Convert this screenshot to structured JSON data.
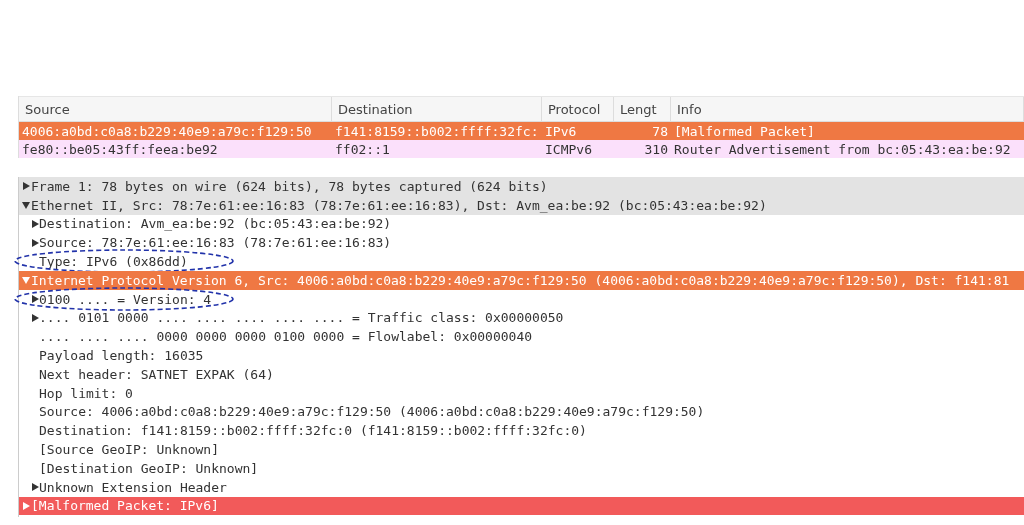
{
  "packet_list": {
    "columns": [
      "Source",
      "Destination",
      "Protocol",
      "Lengt",
      "Info"
    ],
    "rows": [
      {
        "cells": [
          "4006:a0bd:c0a8:b229:40e9:a79c:f129:50",
          "f141:8159::b002:ffff:32fc:",
          "IPv6",
          "78",
          "[Malformed Packet]"
        ],
        "color": "#ef7843"
      },
      {
        "cells": [
          "fe80::be05:43ff:feea:be92",
          "ff02::1",
          "ICMPv6",
          "310",
          "Router Advertisement from bc:05:43:ea:be:92"
        ],
        "color": "#fbe0fb"
      }
    ]
  },
  "details": [
    {
      "label": "Frame 1: 78 bytes on wire (624 bits), 78 bytes captured (624 bits)",
      "expanded": false,
      "color": "#e3e3e3",
      "circled": false
    },
    {
      "label": "Ethernet II, Src: 78:7e:61:ee:16:83 (78:7e:61:ee:16:83), Dst: Avm_ea:be:92 (bc:05:43:ea:be:92)",
      "expanded": true,
      "color": "#e3e3e3",
      "circled": false,
      "children": [
        {
          "label": "Destination: Avm_ea:be:92 (bc:05:43:ea:be:92)",
          "expanded": false,
          "circled": false
        },
        {
          "label": "Source: 78:7e:61:ee:16:83 (78:7e:61:ee:16:83)",
          "expanded": false,
          "circled": false
        },
        {
          "label": "Type: IPv6 (0x86dd)",
          "circled": true
        }
      ]
    },
    {
      "label": "Internet Protocol Version 6, Src: 4006:a0bd:c0a8:b229:40e9:a79c:f129:50 (4006:a0bd:c0a8:b229:40e9:a79c:f129:50), Dst: f141:81",
      "expanded": true,
      "color": "#ef7843",
      "circled": false,
      "children": [
        {
          "label": "0100 .... = Version: 4",
          "expanded": false,
          "circled": true
        },
        {
          "label": ".... 0101 0000 .... .... .... .... .... = Traffic class: 0x00000050",
          "expanded": false,
          "circled": false
        },
        {
          "label": ".... .... .... 0000 0000 0000 0100 0000 = Flowlabel: 0x00000040",
          "circled": false
        },
        {
          "label": "Payload length: 16035",
          "circled": false
        },
        {
          "label": "Next header: SATNET EXPAK (64)",
          "circled": false
        },
        {
          "label": "Hop limit: 0",
          "circled": false
        },
        {
          "label": "Source: 4006:a0bd:c0a8:b229:40e9:a79c:f129:50 (4006:a0bd:c0a8:b229:40e9:a79c:f129:50)",
          "circled": false
        },
        {
          "label": "Destination: f141:8159::b002:ffff:32fc:0 (f141:8159::b002:ffff:32fc:0)",
          "circled": false
        },
        {
          "label": "[Source GeoIP: Unknown]",
          "circled": false
        },
        {
          "label": "[Destination GeoIP: Unknown]",
          "circled": false
        },
        {
          "label": "Unknown Extension Header",
          "expanded": false,
          "circled": false
        }
      ]
    },
    {
      "label": "[Malformed Packet: IPv6]",
      "expanded": false,
      "color": "#f25a5a",
      "circled": false
    }
  ]
}
